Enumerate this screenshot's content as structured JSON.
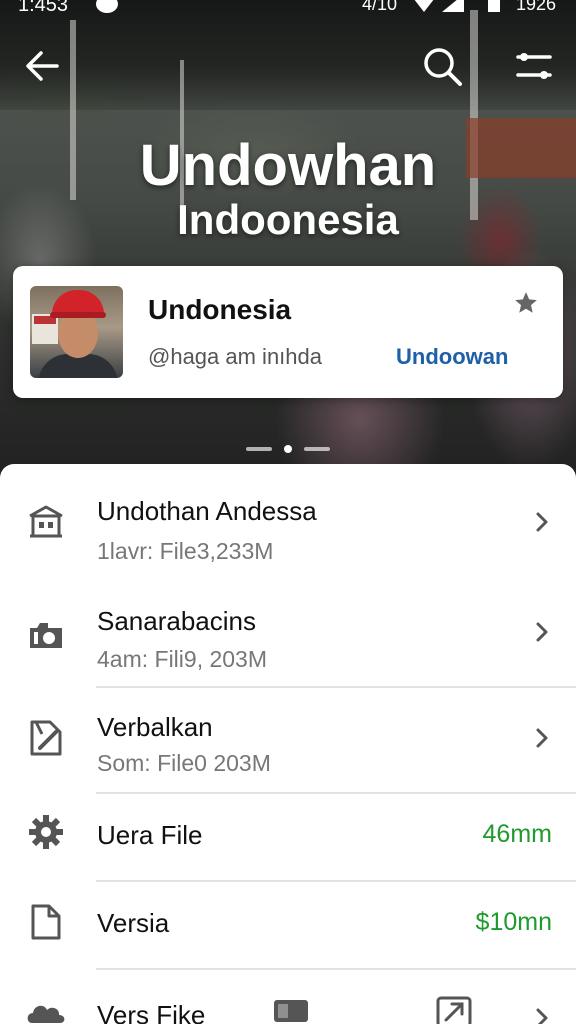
{
  "status_bar": {
    "time": "1:453",
    "date": "4/10",
    "battery": "1926"
  },
  "app_bar": {
    "back_icon": "arrow-left-icon",
    "search_icon": "search-icon",
    "filter_icon": "filter-icon"
  },
  "hero": {
    "title": "Undowhan",
    "subtitle": "Indoonesia"
  },
  "profile_card": {
    "name": "Undonesia",
    "handle": "@haga am  inıhda",
    "link": "Undoowan",
    "star_icon": "star-icon"
  },
  "pager": {
    "pages": 3,
    "active": 2
  },
  "list": [
    {
      "title": "Undothan Andessa",
      "subtitle": "1lavr: File3,233M",
      "icon": "building-icon",
      "trailing": "chevron"
    },
    {
      "title": "Sanarabacins",
      "subtitle": "4am: Fili9, 203M",
      "icon": "camera-icon",
      "trailing": "chevron"
    },
    {
      "title": "Verbalkan",
      "subtitle": "Som: File0 203M",
      "icon": "document-edit-icon",
      "trailing": "chevron"
    },
    {
      "title": "Uera File",
      "subtitle": "",
      "icon": "gear-icon",
      "trailing": "value",
      "value": "46mm"
    },
    {
      "title": "Versia",
      "subtitle": "",
      "icon": "file-icon",
      "trailing": "value",
      "value": "$10mn"
    },
    {
      "title": "Vers Fike",
      "subtitle": "",
      "icon": "cloud-icon",
      "trailing": "chevron"
    }
  ],
  "colors": {
    "accent_link": "#1e5fa8",
    "value_green": "#1f9a2c",
    "icon_gray": "#555555"
  }
}
